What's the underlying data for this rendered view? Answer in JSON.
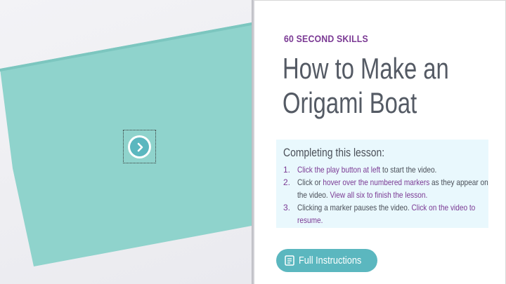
{
  "video": {
    "play_icon": "play-chevron-icon"
  },
  "lesson": {
    "series": "60 SECOND SKILLS",
    "title_line1": "How to Make an",
    "title_line2": "Origami Boat",
    "box_heading": "Completing this lesson:",
    "steps": [
      {
        "num": "1.",
        "parts": [
          {
            "text": "Click the play button at left",
            "hl": true
          },
          {
            "text": " to start the video.",
            "hl": false
          }
        ]
      },
      {
        "num": "2.",
        "parts": [
          {
            "text": "Click or ",
            "hl": false
          },
          {
            "text": "hover over the numbered markers",
            "hl": true
          },
          {
            "text": " as they appear on the video. ",
            "hl": false
          },
          {
            "text": "View all six to finish the lesson.",
            "hl": true
          }
        ]
      },
      {
        "num": "3.",
        "parts": [
          {
            "text": "Clicking a marker pauses the video. ",
            "hl": false
          },
          {
            "text": "Click on the video to resume.",
            "hl": true
          }
        ]
      }
    ]
  },
  "buttons": {
    "full_instructions": "Full Instructions",
    "full_instructions_icon": "document-icon"
  },
  "colors": {
    "accent_purple": "#7b3a94",
    "accent_teal": "#5bb7bf",
    "paper_teal": "#8fd3cc",
    "box_bg": "#e9f8fd",
    "title_gray": "#545a64"
  }
}
